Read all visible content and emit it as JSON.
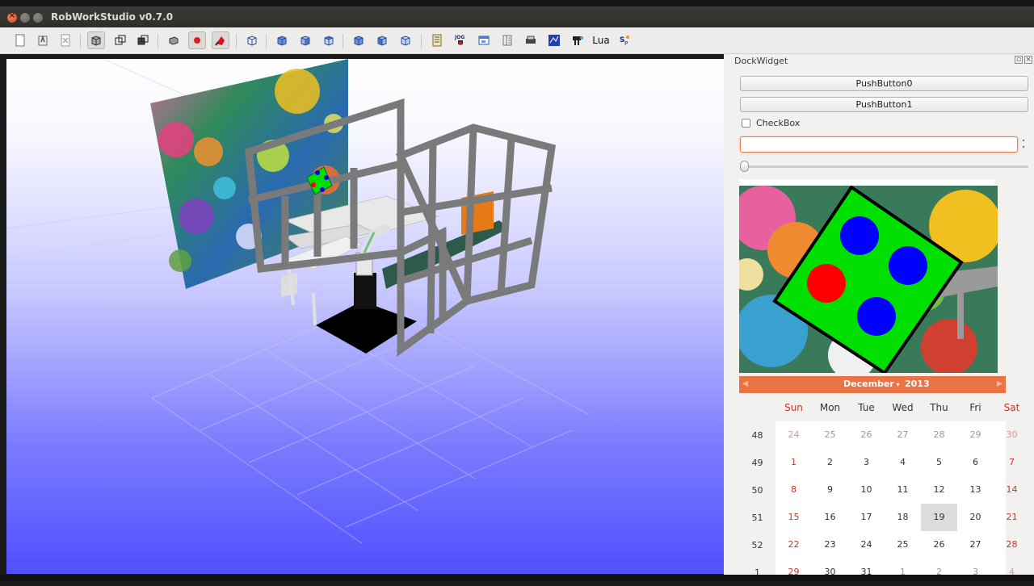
{
  "window": {
    "title": "RobWorkStudio v0.7.0"
  },
  "toolbar": {
    "icons": [
      "new-icon",
      "open-icon",
      "close-icon",
      "solid-view-icon",
      "wireframe-icon",
      "outline-view-icon",
      "solid-icon",
      "record-icon",
      "stop-icon",
      "camera-icon",
      "front-view-icon",
      "side-view-icon",
      "top-view-icon",
      "view-4-icon",
      "view-5-icon",
      "view-6-icon",
      "log-plugin-icon",
      "jog-plugin-icon",
      "tree-view-icon",
      "property-icon",
      "treeview-icon",
      "planning-icon",
      "sensors-icon",
      "lua-plugin",
      "sample-plugin-icon"
    ],
    "jog_label": "JOG",
    "lua_label": "Lua"
  },
  "dock": {
    "title": "DockWidget",
    "pushbutton0": "PushButton0",
    "pushbutton1": "PushButton1",
    "checkbox_label": "CheckBox",
    "spinbox_value": "",
    "slider_value": 0
  },
  "calendar": {
    "month": "December",
    "year": "2013",
    "weekdays": [
      "Sun",
      "Mon",
      "Tue",
      "Wed",
      "Thu",
      "Fri",
      "Sat"
    ],
    "weeks": [
      "48",
      "49",
      "50",
      "51",
      "52",
      "1"
    ],
    "days": [
      [
        "24",
        "25",
        "26",
        "27",
        "28",
        "29",
        "30"
      ],
      [
        "1",
        "2",
        "3",
        "4",
        "5",
        "6",
        "7"
      ],
      [
        "8",
        "9",
        "10",
        "11",
        "12",
        "13",
        "14"
      ],
      [
        "15",
        "16",
        "17",
        "18",
        "19",
        "20",
        "21"
      ],
      [
        "22",
        "23",
        "24",
        "25",
        "26",
        "27",
        "28"
      ],
      [
        "29",
        "30",
        "31",
        "1",
        "2",
        "3",
        "4"
      ]
    ],
    "selected": "19"
  },
  "colors": {
    "accent": "#ea7346",
    "weekend": "#c0392b",
    "marker_green": "#00e000",
    "marker_blue": "#0000ff",
    "marker_red": "#ff0000"
  }
}
